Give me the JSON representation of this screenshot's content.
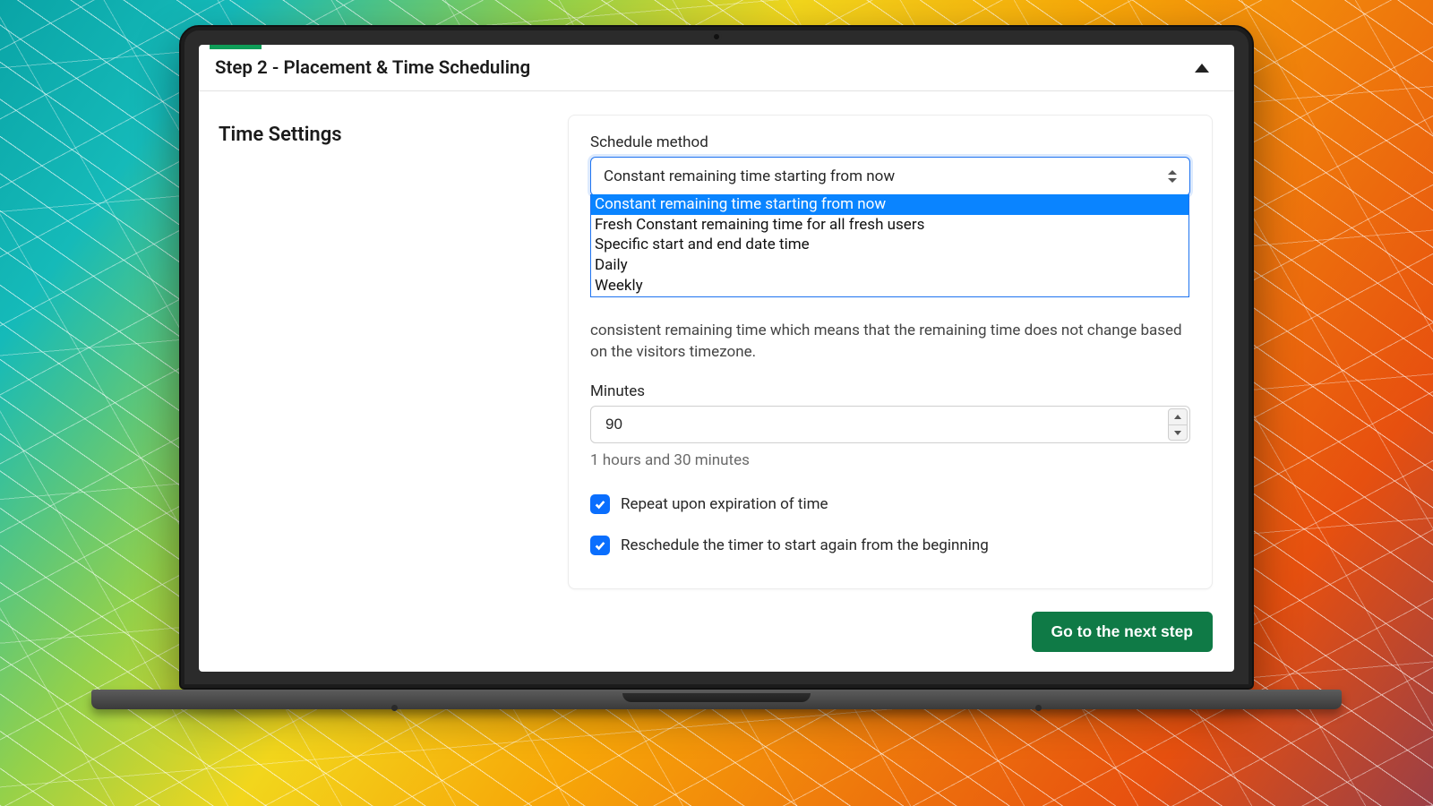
{
  "header": {
    "title": "Step 2 - Placement & Time Scheduling"
  },
  "sidebar": {
    "section_title": "Time Settings"
  },
  "schedule": {
    "label": "Schedule method",
    "selected": "Constant remaining time starting from now",
    "options": [
      "Constant remaining time starting from now",
      "Fresh Constant remaining time for all fresh users",
      "Specific start and end date time",
      "Daily",
      "Weekly"
    ],
    "help_text_partial": "consistent remaining time which means that the remaining time does not change based on the visitors timezone."
  },
  "minutes": {
    "label": "Minutes",
    "value": "90",
    "hint": "1 hours and 30 minutes"
  },
  "checks": {
    "repeat": "Repeat upon expiration of time",
    "reschedule": "Reschedule the timer to start again from the beginning"
  },
  "footer": {
    "next": "Go to the next step"
  },
  "colors": {
    "accent_green": "#0f7a46",
    "accent_blue": "#0a6efd",
    "focus_blue": "#1e73f0"
  }
}
